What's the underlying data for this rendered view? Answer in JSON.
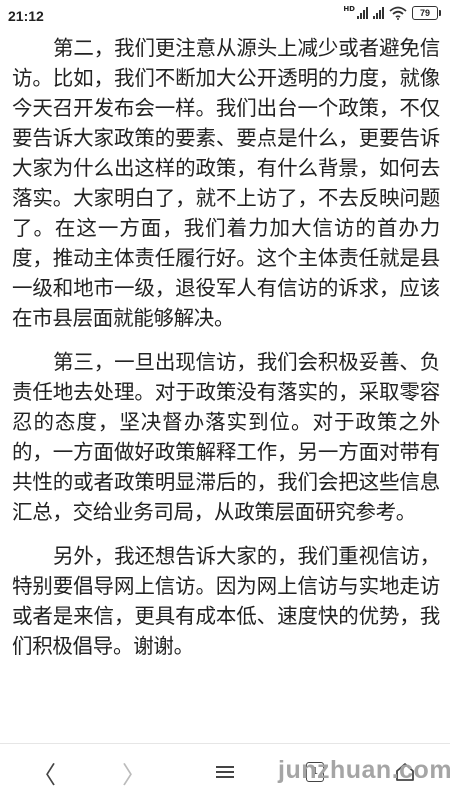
{
  "status_bar": {
    "time": "21:12",
    "network_label": "HD",
    "battery": "79",
    "icons": [
      "signal-icon",
      "signal-icon",
      "wifi-icon",
      "battery-icon"
    ]
  },
  "article": {
    "paragraphs": [
      "第二，我们更注意从源头上减少或者避免信访。比如，我们不断加大公开透明的力度，就像今天召开发布会一样。我们出台一个政策，不仅要告诉大家政策的要素、要点是什么，更要告诉大家为什么出这样的政策，有什么背景，如何去落实。大家明白了，就不上访了，不去反映问题了。在这一方面，我们着力加大信访的首办力度，推动主体责任履行好。这个主体责任就是县一级和地市一级，退役军人有信访的诉求，应该在市县层面就能够解决。",
      "第三，一旦出现信访，我们会积极妥善、负责任地去处理。对于政策没有落实的，采取零容忍的态度，坚决督办落实到位。对于政策之外的，一方面做好政策解释工作，另一方面对带有共性的或者政策明显滞后的，我们会把这些信息汇总，交给业务司局，从政策层面研究参考。",
      "另外，我还想告诉大家的，我们重视信访，特别要倡导网上信访。因为网上信访与实地走访或者是来信，更具有成本低、速度快的优势，我们积极倡导。谢谢。"
    ]
  },
  "bottom_nav": {
    "back_glyph": "〈",
    "forward_glyph": "〉",
    "tabs_count": "1",
    "icons": [
      "back-icon",
      "forward-icon",
      "menu-icon",
      "tabs-icon",
      "home-icon"
    ]
  },
  "watermark": {
    "text": "junzhuan.com"
  }
}
